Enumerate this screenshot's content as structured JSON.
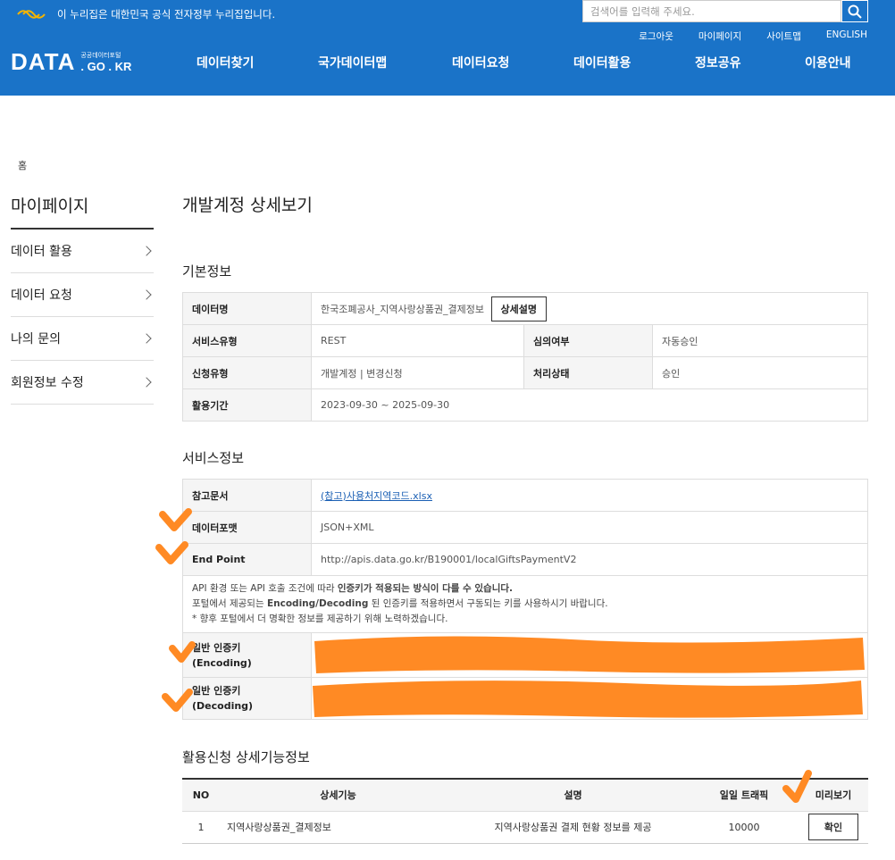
{
  "header": {
    "gov_banner": "이 누리집은 대한민국 공식 전자정부 누리집입니다.",
    "search_placeholder": "검색어를 입력해 주세요.",
    "util_nav": [
      "로그아웃",
      "마이페이지",
      "사이트맵",
      "ENGLISH"
    ],
    "logo_main": "DATA",
    "logo_sub1": "공공데이터포털",
    "logo_sub2": ". GO . KR",
    "gnb": [
      "데이터찾기",
      "국가데이터맵",
      "데이터요청",
      "데이터활용",
      "정보공유",
      "이용안내"
    ]
  },
  "breadcrumb": "홈",
  "sidebar": {
    "title": "마이페이지",
    "items": [
      {
        "label": "데이터 활용"
      },
      {
        "label": "데이터 요청"
      },
      {
        "label": "나의 문의"
      },
      {
        "label": "회원정보 수정"
      }
    ]
  },
  "page_title": "개발계정 상세보기",
  "basic_info": {
    "section_title": "기본정보",
    "data_name_label": "데이터명",
    "data_name_value": "한국조폐공사_지역사랑상품권_결제정보",
    "detail_button": "상세설명",
    "service_type_label": "서비스유형",
    "service_type_value": "REST",
    "review_label": "심의여부",
    "review_value": "자동승인",
    "request_type_label": "신청유형",
    "request_type_value": "개발계정 | 변경신청",
    "status_label": "처리상태",
    "status_value": "승인",
    "period_label": "활용기간",
    "period_value": "2023-09-30 ~ 2025-09-30"
  },
  "service_info": {
    "section_title": "서비스정보",
    "ref_doc_label": "참고문서",
    "ref_doc_value": "(참고)사용처지역코드.xlsx",
    "format_label": "데이터포맷",
    "format_value": "JSON+XML",
    "endpoint_label": "End Point",
    "endpoint_value": "http://apis.data.go.kr/B190001/localGiftsPaymentV2",
    "notice_line1_a": "API 환경 또는 API 호출 조건에 따라 ",
    "notice_line1_b": "인증키가 적용되는 방식이 다를 수 있습니다.",
    "notice_line2_a": "포털에서 제공되는 ",
    "notice_line2_b": "Encoding/Decoding",
    "notice_line2_c": " 된 인증키를 적용하면서 구동되는 키를 사용하시기 바랍니다.",
    "notice_line3": "* 향후 포털에서 더 명확한 정보를 제공하기 위해 노력하겠습니다.",
    "key_enc_label1": "일반 인증키",
    "key_enc_label2": "(Encoding)",
    "key_dec_label1": "일반 인증키",
    "key_dec_label2": "(Decoding)"
  },
  "func_info": {
    "section_title": "활용신청 상세기능정보",
    "columns": [
      "NO",
      "상세기능",
      "설명",
      "일일 트래픽",
      "미리보기"
    ],
    "rows": [
      {
        "no": "1",
        "func": "지역사랑상품권_결제정보",
        "desc": "지역사랑상품권 결제 현황 정보를 제공",
        "traffic": "10000",
        "button": "확인"
      }
    ]
  },
  "colors": {
    "header_bg": "#1a73c8",
    "annotation": "#ff8a24"
  }
}
